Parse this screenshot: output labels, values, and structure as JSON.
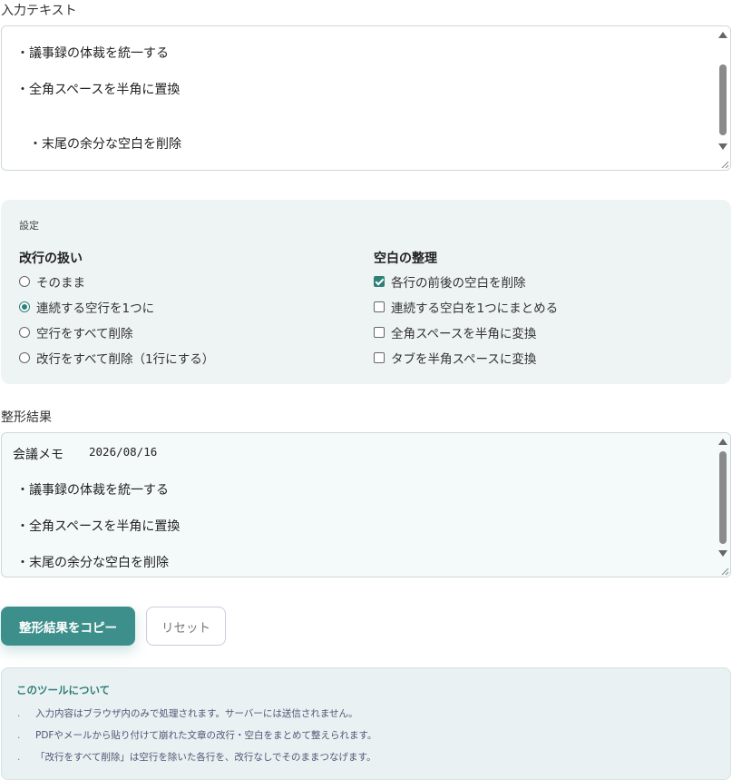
{
  "input": {
    "label": "入力テキスト",
    "lines": [
      "・議事録の体裁を統一する",
      "・全角スペースを半角に置換",
      "　・末尾の余分な空白を削除"
    ]
  },
  "settings": {
    "title": "設定",
    "newline": {
      "title": "改行の扱い",
      "options": [
        "そのまま",
        "連続する空行を1つに",
        "空行をすべて削除",
        "改行をすべて削除（1行にする）"
      ],
      "selected_index": 1
    },
    "whitespace": {
      "title": "空白の整理",
      "options": [
        {
          "label": "各行の前後の空白を削除",
          "checked": true
        },
        {
          "label": "連続する空白を1つにまとめる",
          "checked": false
        },
        {
          "label": "全角スペースを半角に変換",
          "checked": false
        },
        {
          "label": "タブを半角スペースに変換",
          "checked": false
        }
      ]
    }
  },
  "output": {
    "label": "整形結果",
    "lines": [
      "会議メモ",
      "2026/08/16",
      "・議事録の体裁を統一する",
      "・全角スペースを半角に置換",
      "・末尾の余分な空白を削除"
    ]
  },
  "buttons": {
    "copy": "整形結果をコピー",
    "reset": "リセット"
  },
  "about": {
    "title": "このツールについて",
    "items": [
      "入力内容はブラウザ内のみで処理されます。サーバーには送信されません。",
      "PDFやメールから貼り付けて崩れた文章の改行・空白をまとめて整えられます。",
      "「改行をすべて削除」は空行を除いた各行を、改行なしでそのままつなげます。"
    ],
    "bullet": "."
  },
  "colors": {
    "accent": "#3d8f8b",
    "panel_bg": "#eef3f3",
    "about_bg": "#e9f1f2"
  }
}
